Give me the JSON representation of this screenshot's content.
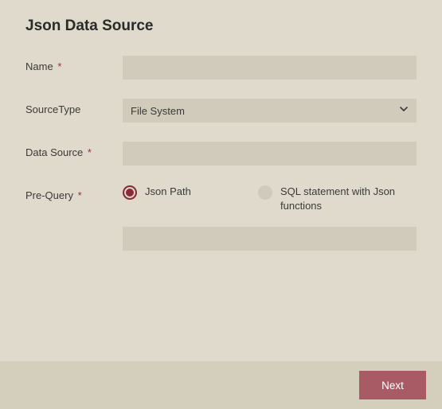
{
  "title": "Json Data Source",
  "fields": {
    "name": {
      "label": "Name",
      "required": true,
      "value": ""
    },
    "sourceType": {
      "label": "SourceType",
      "required": false,
      "selected": "File System"
    },
    "dataSource": {
      "label": "Data Source",
      "required": true,
      "value": ""
    },
    "preQuery": {
      "label": "Pre-Query",
      "required": true,
      "options": {
        "jsonPath": "Json Path",
        "sqlJson": "SQL statement with Json functions"
      },
      "value": ""
    }
  },
  "buttons": {
    "next": "Next"
  },
  "requiredMark": "*"
}
